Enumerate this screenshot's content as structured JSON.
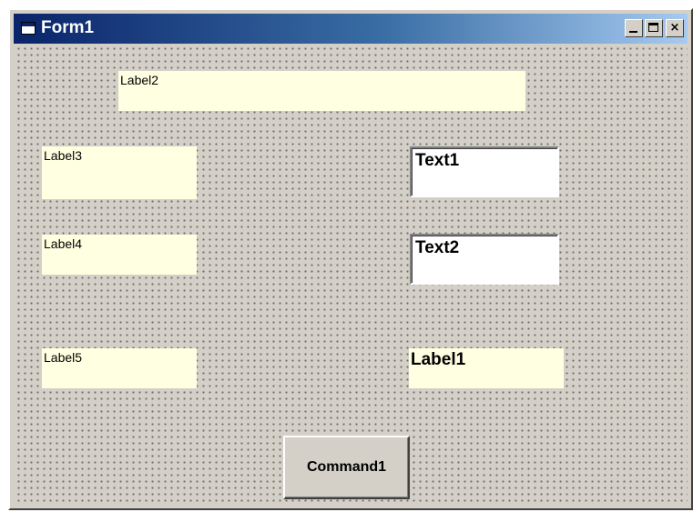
{
  "window": {
    "title": "Form1",
    "minimize_icon": "minimize-icon",
    "maximize_icon": "maximize-icon",
    "close_glyph": "×"
  },
  "form": {
    "label2": "Label2",
    "label3": "Label3",
    "label4": "Label4",
    "label5": "Label5",
    "label1": "Label1",
    "text1": "Text1",
    "text2": "Text2",
    "command1": "Command1"
  },
  "colors": {
    "form_background": "#d4d0c8",
    "label_background": "#ffffe1",
    "titlebar_start": "#0a246a",
    "titlebar_end": "#a6caf0"
  }
}
